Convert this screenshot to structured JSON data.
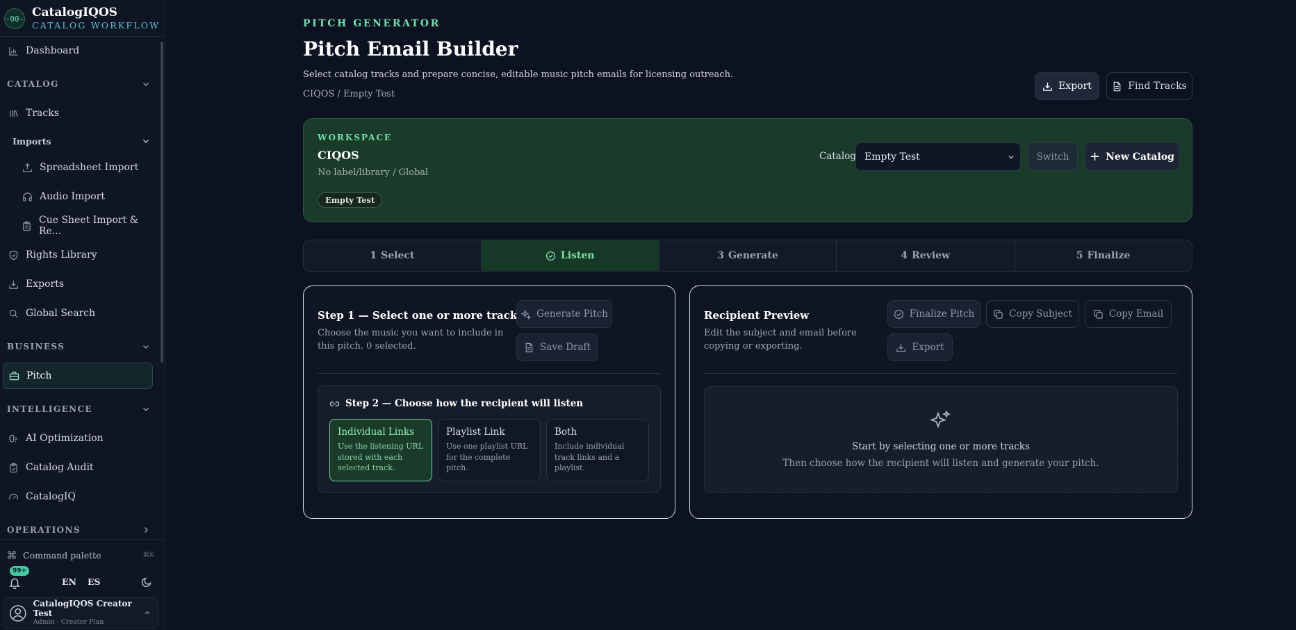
{
  "brand": {
    "name": "CatalogIQOS",
    "subtitle": "CATALOG WORKFLOW",
    "logo_text": "-00-"
  },
  "sidebar": {
    "dashboard": "Dashboard",
    "sections": {
      "catalog": "CATALOG",
      "business": "BUSINESS",
      "intelligence": "INTELLIGENCE",
      "operations": "OPERATIONS"
    },
    "tracks": "Tracks",
    "imports_label": "Imports",
    "spreadsheet_import": "Spreadsheet Import",
    "audio_import": "Audio Import",
    "cue_sheet_import": "Cue Sheet Import & Re...",
    "rights_library": "Rights Library",
    "exports": "Exports",
    "global_search": "Global Search",
    "pitch": "Pitch",
    "ai_optimization": "AI Optimization",
    "catalog_audit": "Catalog Audit",
    "catalogiq": "CatalogIQ",
    "command_palette": "Command palette",
    "command_shortcut": "⌘K",
    "notification_badge": "99+",
    "lang_en": "EN",
    "lang_es": "ES",
    "user_name": "CatalogIQOS Creator Test",
    "user_role": "Admin · Creator Plan"
  },
  "header": {
    "eyebrow": "PITCH GENERATOR",
    "title": "Pitch Email Builder",
    "description": "Select catalog tracks and prepare concise, editable music pitch emails for licensing outreach.",
    "breadcrumb": "CIQOS / Empty Test",
    "export_label": "Export",
    "find_tracks_label": "Find Tracks"
  },
  "workspace": {
    "label": "WORKSPACE",
    "name": "CIQOS",
    "meta": "No label/library / Global",
    "chip": "Empty Test",
    "catalog_label": "Catalog",
    "catalog_selected": "Empty Test",
    "switch_label": "Switch",
    "new_catalog_label": "New Catalog"
  },
  "steps": [
    {
      "num": "1",
      "label": "Select"
    },
    {
      "num": "",
      "label": "Listen"
    },
    {
      "num": "3",
      "label": "Generate"
    },
    {
      "num": "4",
      "label": "Review"
    },
    {
      "num": "5",
      "label": "Finalize"
    }
  ],
  "select_card": {
    "title": "Step 1 — Select one or more tracks",
    "description": "Choose the music you want to include in this pitch. 0 selected.",
    "generate_label": "Generate Pitch",
    "save_draft_label": "Save Draft",
    "listen_title": "Step 2 — Choose how the recipient will listen",
    "options": [
      {
        "title": "Individual Links",
        "desc": "Use the listening URL stored with each selected track."
      },
      {
        "title": "Playlist Link",
        "desc": "Use one playlist URL for the complete pitch."
      },
      {
        "title": "Both",
        "desc": "Include individual track links and a playlist."
      }
    ]
  },
  "preview_card": {
    "title": "Recipient Preview",
    "description": "Edit the subject and email before copying or exporting.",
    "finalize_label": "Finalize Pitch",
    "copy_subject_label": "Copy Subject",
    "copy_email_label": "Copy Email",
    "export_label": "Export",
    "empty_title": "Start by selecting one or more tracks",
    "empty_sub": "Then choose how the recipient will listen and generate your pitch."
  },
  "colors": {
    "accent": "#6fe0ae",
    "workspace_bg": "#1a3a2a",
    "active_step_bg": "#163826",
    "background": "#0d1220"
  }
}
